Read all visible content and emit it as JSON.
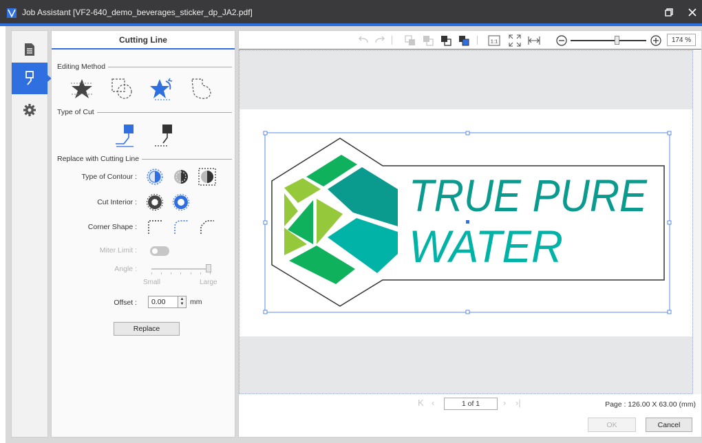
{
  "window": {
    "title": "Job Assistant [VF2-640_demo_beverages_sticker_dp_JA2.pdf]",
    "icons": [
      "app-logo-icon",
      "restore-icon",
      "close-icon"
    ]
  },
  "side_nav": {
    "items": [
      {
        "name": "document-icon",
        "active": false
      },
      {
        "name": "cutting-pen-icon",
        "active": true
      },
      {
        "name": "gear-icon",
        "active": false
      }
    ]
  },
  "panel": {
    "title": "Cutting Line",
    "editing_method": {
      "label": "Editing Method",
      "tools": [
        "star-tool-icon",
        "dashed-shape-select-icon",
        "magic-star-icon",
        "dashed-freeform-icon"
      ],
      "selected_index": 2
    },
    "type_of_cut": {
      "label": "Type of Cut",
      "options": [
        "blue-cutter-icon",
        "black-cutter-icon"
      ],
      "selected_index": 0
    },
    "replace": {
      "label": "Replace with Cutting Line",
      "type_of_contour_label": "Type of Contour :",
      "cut_interior_label": "Cut Interior :",
      "corner_shape_label": "Corner Shape :",
      "miter_limit_label": "Miter Limit :",
      "angle_label": "Angle :",
      "angle_small": "Small",
      "angle_large": "Large",
      "offset_label": "Offset :",
      "offset_value": "0.00",
      "offset_unit": "mm",
      "replace_button": "Replace"
    }
  },
  "toolbar": {
    "zoom_value": "174 %",
    "icons": [
      "undo-icon",
      "redo-icon",
      "bring-forward-icon",
      "send-backward-icon",
      "bring-to-front-icon",
      "send-to-back-icon",
      "actual-size-icon",
      "fit-page-icon",
      "fit-width-icon",
      "zoom-out-icon",
      "zoom-in-icon"
    ]
  },
  "artwork": {
    "line1": "TRUE PURE",
    "line2": "WATER",
    "colors": {
      "teal": "#0a9a8e",
      "green": "#0fb15c",
      "lime": "#96c83c",
      "dark_teal": "#07857d"
    }
  },
  "footer": {
    "page_indicator": "1 of 1",
    "page_size": "Page : 126.00 X 63.00 (mm)",
    "ok_label": "OK",
    "cancel_label": "Cancel"
  },
  "accent_color": "#2f6fe0"
}
